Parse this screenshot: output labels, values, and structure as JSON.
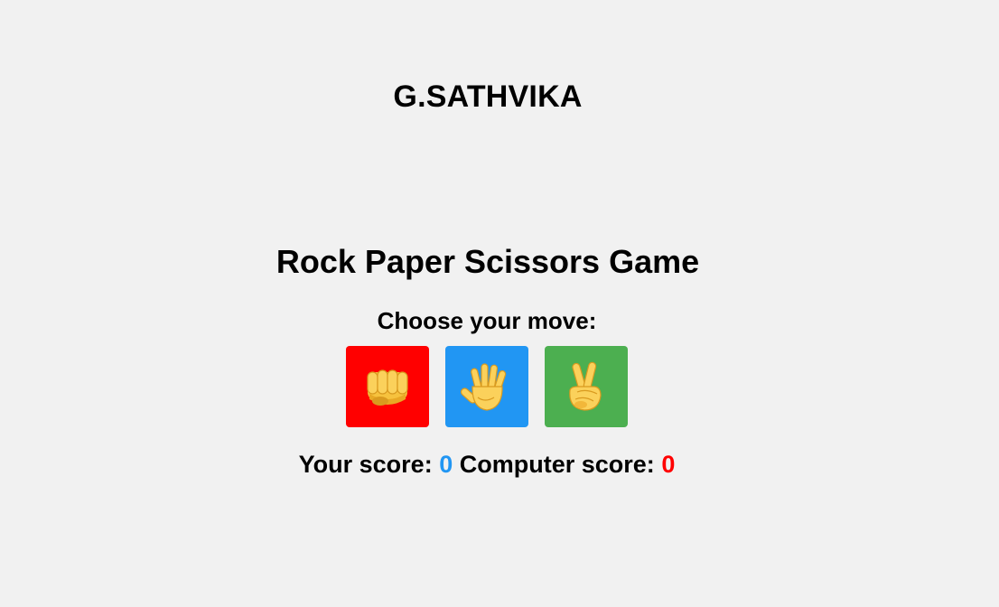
{
  "header": {
    "author": "G.SATHVIKA"
  },
  "game": {
    "title": "Rock Paper Scissors Game",
    "prompt": "Choose your move:",
    "moves": [
      {
        "name": "rock",
        "icon": "fist-icon",
        "color": "#ff0000"
      },
      {
        "name": "paper",
        "icon": "raised-hand-icon",
        "color": "#2196f3"
      },
      {
        "name": "scissors",
        "icon": "victory-hand-icon",
        "color": "#4caf50"
      }
    ]
  },
  "scores": {
    "your_label": "Your score:",
    "your_value": "0",
    "your_color": "#2196f3",
    "computer_label": "Computer score:",
    "computer_value": "0",
    "computer_color": "#ff0000"
  }
}
